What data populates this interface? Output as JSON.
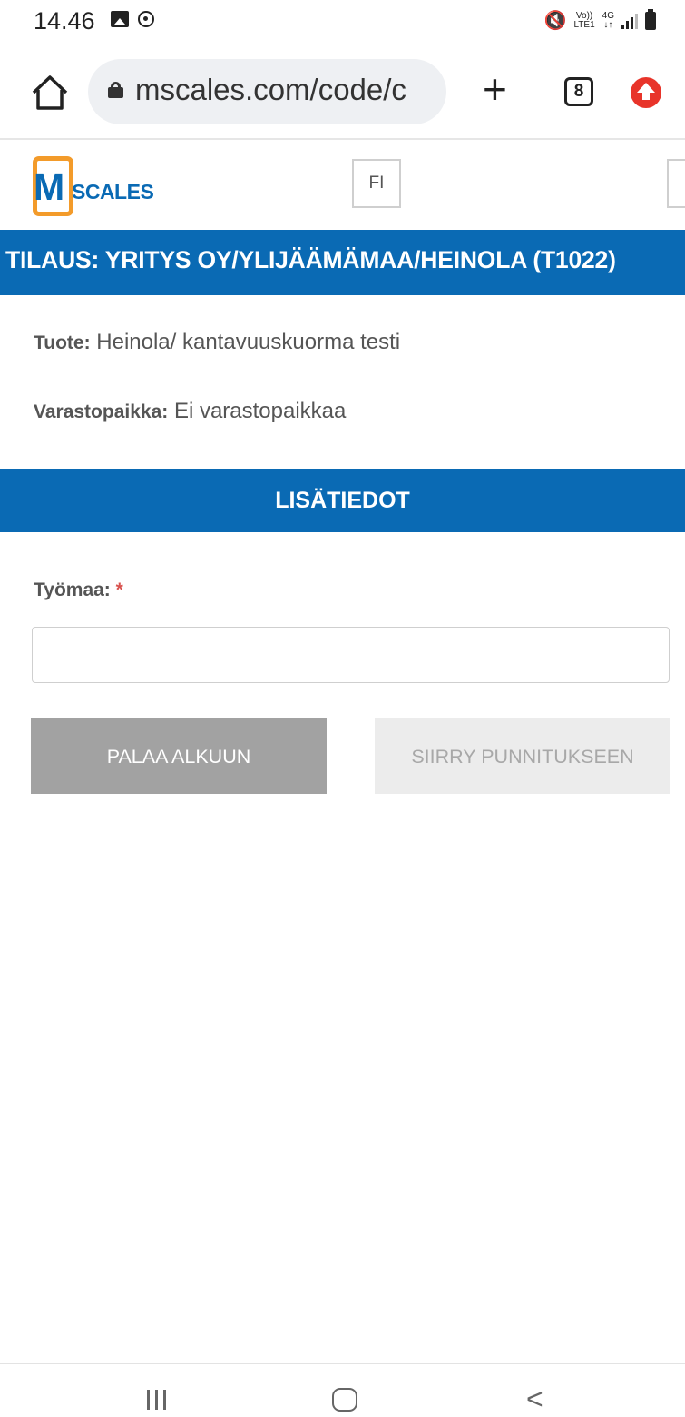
{
  "status_bar": {
    "time": "14.46",
    "volte_top": "Vo))",
    "volte_bottom": "LTE1",
    "net_top": "4G",
    "net_bottom": "↓↑"
  },
  "browser": {
    "url": "mscales.com/code/c",
    "tabs_count": "8"
  },
  "app": {
    "logo_letter": "M",
    "logo_text": "SCALES",
    "language": "FI"
  },
  "order": {
    "title": "TILAUS: YRITYS OY/YLIJÄÄMÄMAA/HEINOLA (T1022)",
    "product_label": "Tuote:",
    "product_value": "Heinola/ kantavuuskuorma testi",
    "storage_label": "Varastopaikka:",
    "storage_value": "Ei varastopaikkaa"
  },
  "details": {
    "section_title": "LISÄTIEDOT",
    "site_label": "Työmaa:",
    "required_mark": "*",
    "site_value": ""
  },
  "actions": {
    "back_label": "PALAA ALKUUN",
    "next_label": "SIIRRY PUNNITUKSEEN"
  },
  "colors": {
    "brand_blue": "#0a6ab4",
    "brand_orange": "#f39b2a",
    "disabled_bg": "#ececec",
    "secondary_bg": "#a2a2a2"
  }
}
